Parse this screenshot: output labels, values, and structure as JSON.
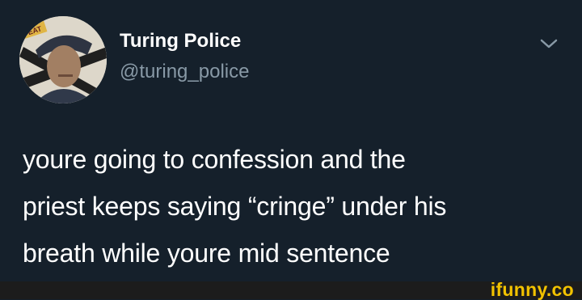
{
  "tweet": {
    "author_name": "Turing Police",
    "author_handle": "@turing_police",
    "text_lines": [
      "youre going to confession and the",
      "priest keeps saying “cringe” under his",
      "breath while youre mid sentence"
    ],
    "avatar_badge": "EAT"
  },
  "icons": {
    "menu": "chevron-down-icon",
    "avatar": "avatar"
  },
  "watermark": {
    "text": "ifunny.co"
  },
  "colors": {
    "background": "#15202b",
    "name": "#ffffff",
    "handle": "#8899a6",
    "body_text": "#ffffff",
    "watermark": "#f2c200",
    "footer": "#1c1c1c"
  }
}
